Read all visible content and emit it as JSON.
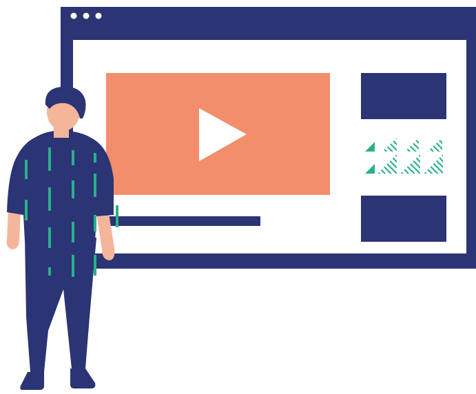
{
  "illustration": {
    "subject": "video-player-browser-window-with-person",
    "colors": {
      "navy": "#2B3474",
      "salmon": "#F28E6B",
      "teal": "#2BAF8A",
      "skin": "#F5B59B",
      "white": "#FFFFFF"
    },
    "window": {
      "title_bar_dots": 3
    },
    "video_player": {
      "play_icon": "play-icon"
    },
    "sidebar": {
      "thumbnails": 2,
      "decorative_pattern": "triangle-pattern-icon"
    }
  }
}
